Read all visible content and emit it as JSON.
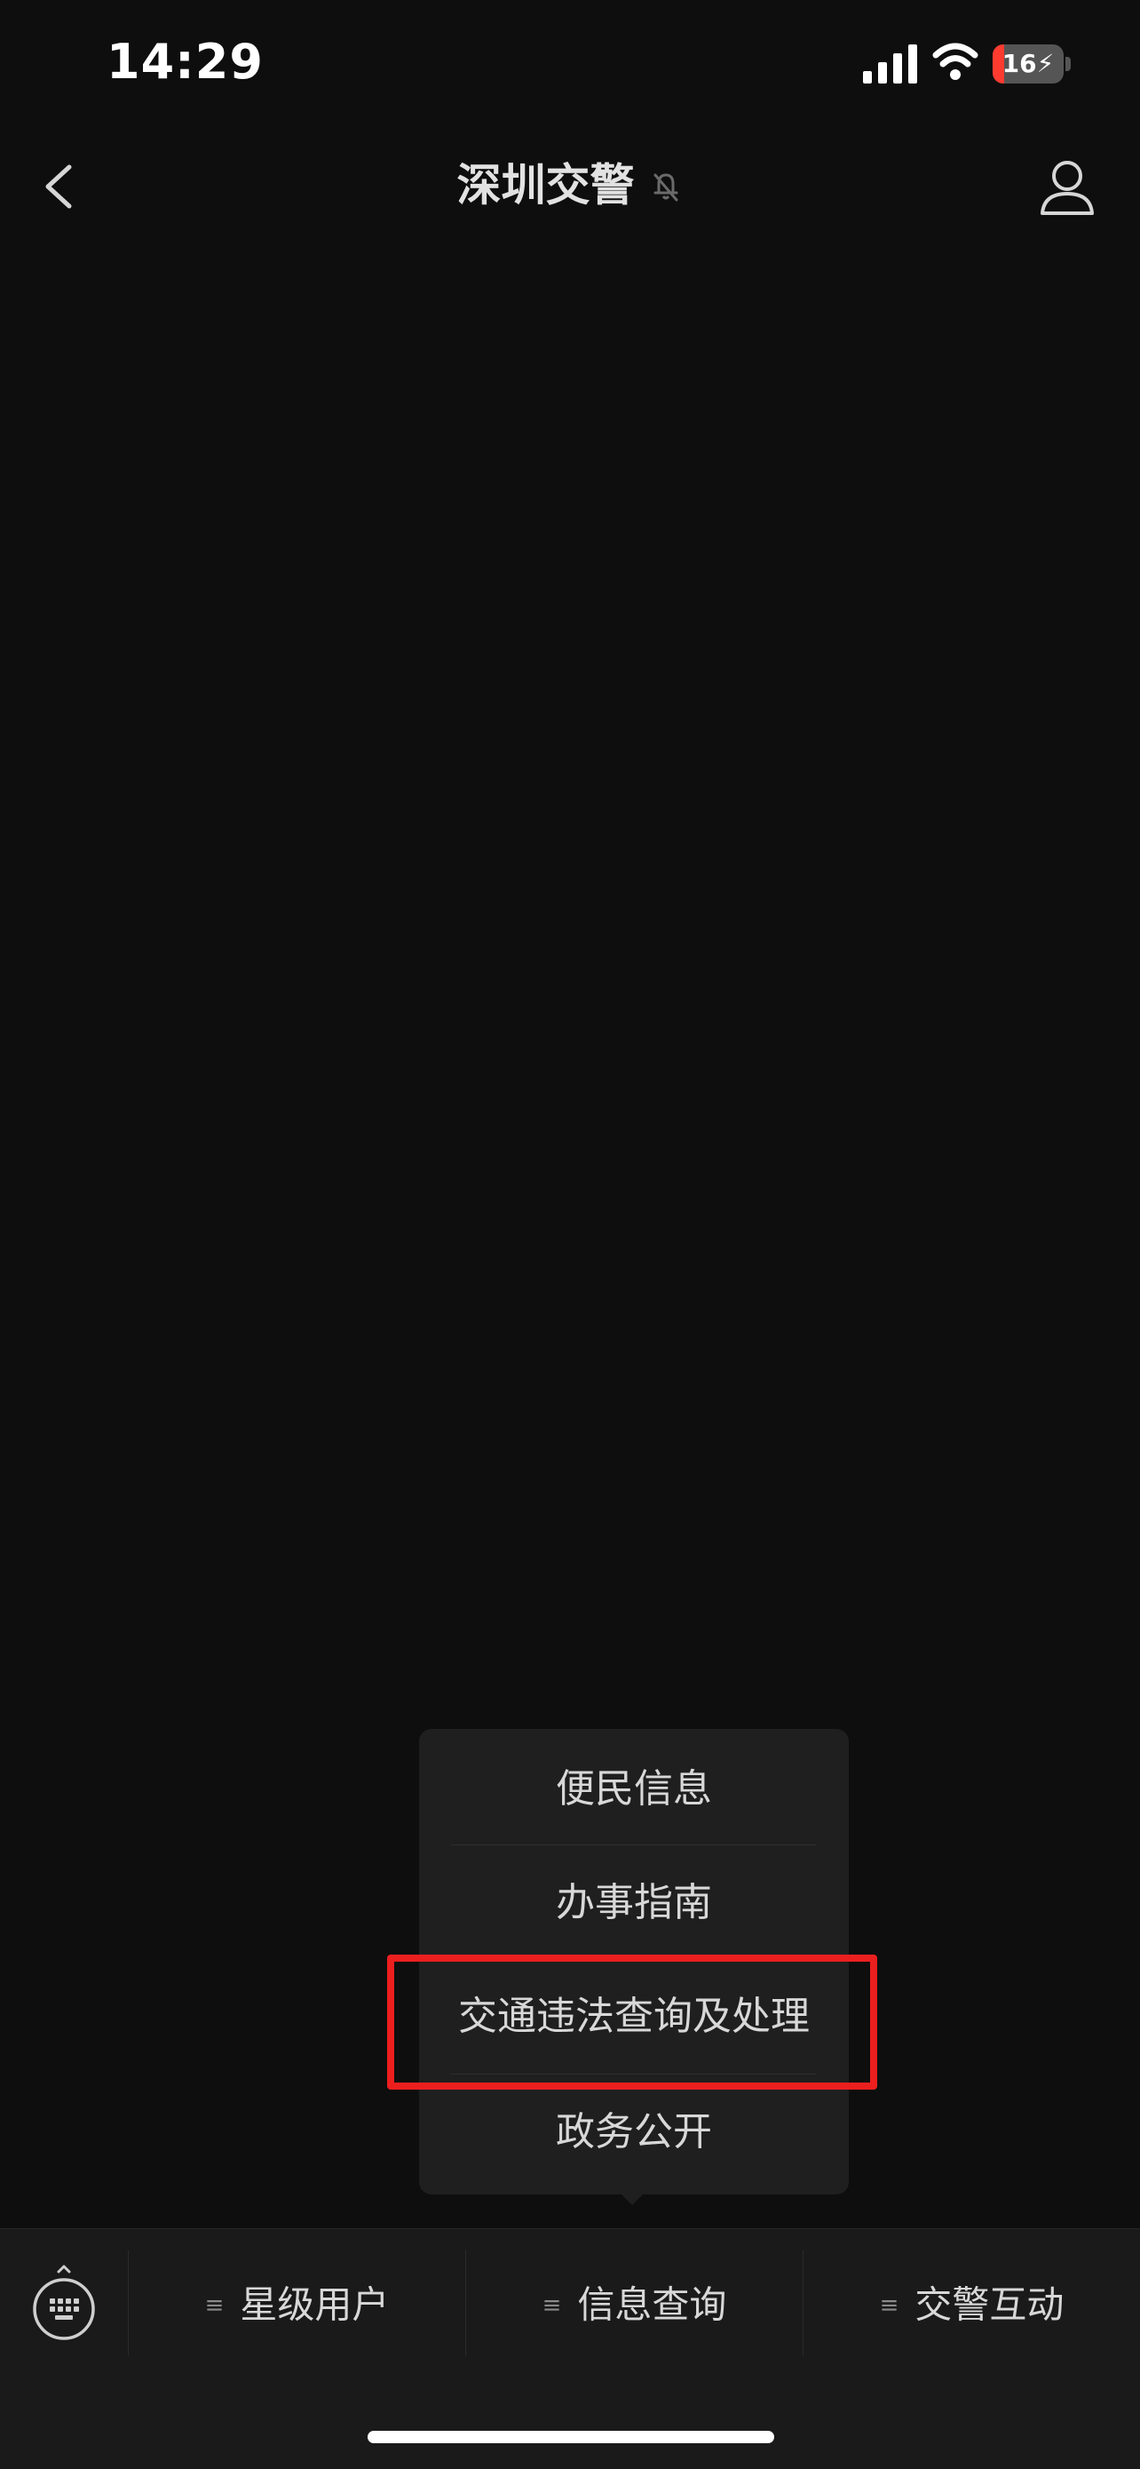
{
  "status_bar": {
    "time": "14:29",
    "battery_level": "16",
    "battery_fraction": 0.16,
    "battery_color": "#ff3b30"
  },
  "nav_bar": {
    "title": "深圳交警",
    "back_icon": "chevron-left-icon",
    "mute_icon": "bell-slash-icon",
    "profile_icon": "person-icon"
  },
  "popup_menu": {
    "items": [
      {
        "label": "便民信息"
      },
      {
        "label": "办事指南"
      },
      {
        "label": "交通违法查询及处理"
      },
      {
        "label": "政务公开"
      }
    ],
    "highlighted_item": "交通违法查询及处理",
    "highlight_color": "#ec1f1f"
  },
  "bottom_menu": {
    "keyboard_icon": "keyboard-icon",
    "menu_glyph": "≡",
    "tabs": [
      {
        "label": "星级用户"
      },
      {
        "label": "信息查询"
      },
      {
        "label": "交警互动"
      }
    ]
  },
  "colors": {
    "background": "#0e0e0e",
    "panel": "#1f1f1f",
    "bottom_bar": "#1a1a1a",
    "text": "#d8d8d8"
  }
}
